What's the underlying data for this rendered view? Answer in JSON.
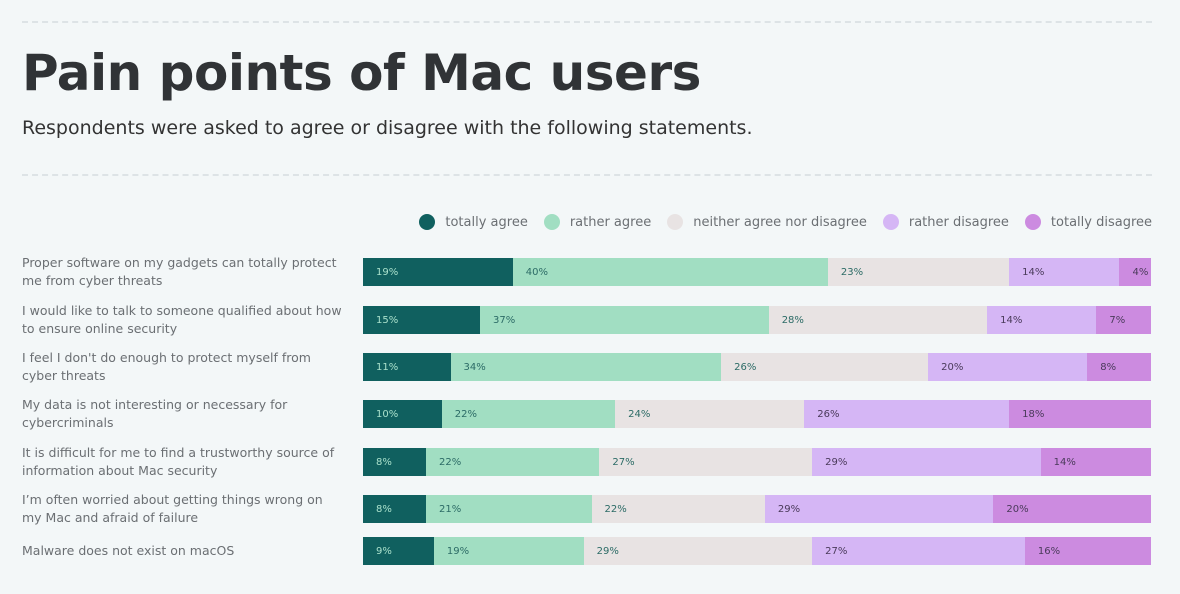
{
  "chart_data": {
    "type": "bar",
    "orientation": "horizontal",
    "stacked": true,
    "title": "Pain points of Mac users",
    "subtitle": "Respondents were asked to agree or disagree with the following statements.",
    "xlabel": "",
    "ylabel": "",
    "xlim": [
      0,
      100
    ],
    "grid": false,
    "legend_position": "top-right",
    "categories": [
      "Proper software on my gadgets can totally protect me from cyber threats",
      "I would like to talk to someone qualified about how to ensure online security",
      "I feel I don't do enough to protect myself from cyber threats",
      "My data is not interesting or necessary for cybercriminals",
      "It is difficult for me to find a trustworthy source of information about Mac security",
      "I’m often worried about getting things wrong on my Mac and afraid of failure",
      "Malware does not exist on macOS"
    ],
    "series": [
      {
        "name": "totally agree",
        "color": "#10605f",
        "label_color": "#a9e0cb",
        "values": [
          19,
          15,
          11,
          10,
          8,
          8,
          9
        ]
      },
      {
        "name": "rather agree",
        "color": "#a1dec2",
        "label_color": "#2c6b66",
        "values": [
          40,
          37,
          34,
          22,
          22,
          21,
          19
        ]
      },
      {
        "name": "neither agree nor disagree",
        "color": "#e8e3e3",
        "label_color": "#2c6b66",
        "values": [
          23,
          28,
          26,
          24,
          27,
          22,
          29
        ]
      },
      {
        "name": "rather disagree",
        "color": "#d5b6f5",
        "label_color": "#4a3a5a",
        "values": [
          14,
          14,
          20,
          26,
          29,
          29,
          27
        ]
      },
      {
        "name": "totally disagree",
        "color": "#cc8be0",
        "label_color": "#4a3a5a",
        "values": [
          4,
          7,
          8,
          18,
          14,
          20,
          16
        ]
      }
    ]
  }
}
